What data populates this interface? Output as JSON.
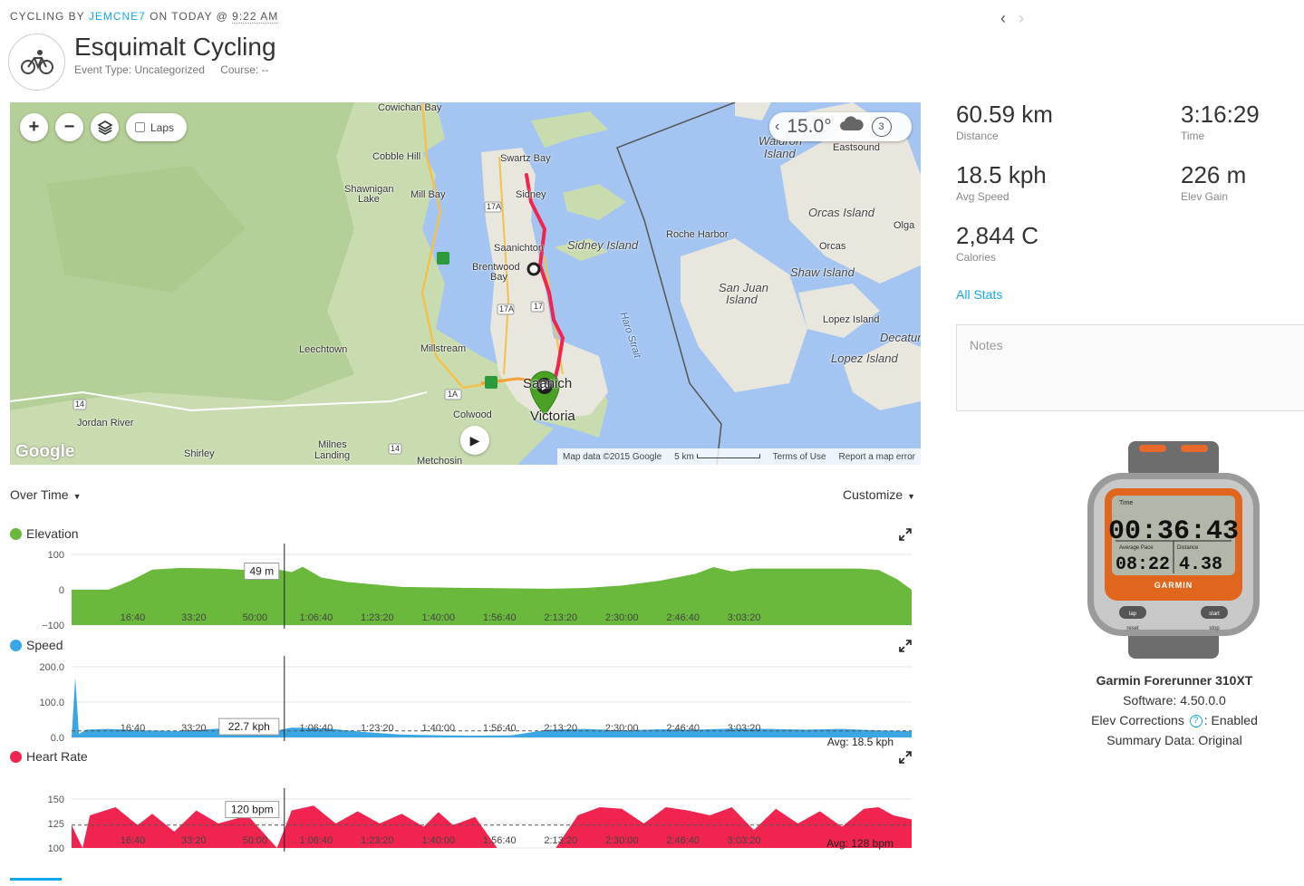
{
  "header": {
    "prefix": "CYCLING BY",
    "user": "JEMCNE7",
    "on": "ON TODAY @",
    "time": "9:22 AM",
    "title": "Esquimalt Cycling",
    "event_type": "Event Type: Uncategorized",
    "course": "Course: --",
    "activity_icon": "bicycle-icon"
  },
  "nav": {
    "prev_icon": "chevron-left-icon",
    "next_icon": "chevron-right-icon"
  },
  "map": {
    "laps_label": "Laps",
    "zoom_in": "+",
    "zoom_out": "−",
    "temperature": "15.0°",
    "weather_count": "3",
    "logo": "Google",
    "footer": {
      "map_data": "Map data ©2015 Google",
      "scale": "5 km",
      "terms": "Terms of Use",
      "report": "Report a map error"
    },
    "labels": {
      "cowichan_bay": "Cowichan Bay",
      "cobble_hill": "Cobble Hill",
      "shawnigan": "Shawnigan",
      "lake": "Lake",
      "mill_bay": "Mill Bay",
      "swartz_bay": "Swartz Bay",
      "sidney": "Sidney",
      "saanichton": "Saanichton",
      "brentwood": "Brentwood",
      "bay": "Bay",
      "sidney_island": "Sidney Island",
      "roche_harbor": "Roche Harbor",
      "waldron": "Waldron",
      "island": "Island",
      "eastsound": "Eastsound",
      "orcas_island": "Orcas Island",
      "orcas": "Orcas",
      "olga": "Olga",
      "shaw_island": "Shaw Island",
      "san_juan": "San Juan",
      "san_juan_island": "Island",
      "haro_strait": "Haro Strait",
      "lopez_island_town": "Lopez Island",
      "decatur": "Decatur",
      "lopez_island": "Lopez Island",
      "leechtown": "Leechtown",
      "millstream": "Millstream",
      "saanich": "Saanich",
      "victoria": "Victoria",
      "colwood": "Colwood",
      "jordan_river": "Jordan River",
      "shirley": "Shirley",
      "milnes": "Milnes",
      "landing": "Landing",
      "metchosin": "Metchosin",
      "hwy_17a_top": "17A",
      "hwy_17a_mid": "17A",
      "hwy_17": "17",
      "hwy_1a": "1A",
      "hwy_14_left": "14",
      "hwy_14_right": "14"
    }
  },
  "stats": [
    {
      "value": "60.59 km",
      "label": "Distance"
    },
    {
      "value": "3:16:29",
      "label": "Time"
    },
    {
      "value": "18.5 kph",
      "label": "Avg Speed"
    },
    {
      "value": "226 m",
      "label": "Elev Gain"
    },
    {
      "value": "2,844 C",
      "label": "Calories"
    }
  ],
  "all_stats": "All Stats",
  "notes_placeholder": "Notes",
  "device": {
    "name": "Garmin Forerunner 310XT",
    "software": "Software: 4.50.0.0",
    "elev_label": "Elev Corrections",
    "elev_value": ": Enabled",
    "summary": "Summary Data: Original",
    "screen_time": "00:36:43",
    "screen_pace": "08:22",
    "screen_distance": "4.38",
    "screen_time_label": "Time",
    "screen_pace_label": "Average Pace",
    "screen_distance_label": "Distance",
    "brand": "GARMIN",
    "lap": "lap",
    "start": "start",
    "reset": "reset",
    "stop": "stop"
  },
  "chart_controls": {
    "over_time": "Over Time",
    "customize": "Customize"
  },
  "colors": {
    "elevation": "#6ab83c",
    "speed": "#3aa7e4",
    "heart_rate": "#f0244f",
    "accent": "#11a9ed"
  },
  "chart_data": [
    {
      "type": "area",
      "title": "Elevation",
      "unit": "m",
      "ylim": [
        -100,
        100
      ],
      "yticks": [
        "100",
        "0",
        "−100"
      ],
      "xticks": [
        "16:40",
        "33:20",
        "50:00",
        "1:06:40",
        "1:23:20",
        "1:40:00",
        "1:56:40",
        "2:13:20",
        "2:30:00",
        "2:46:40",
        "3:03:20"
      ],
      "hover_label": "49 m",
      "x_minutes": [
        0,
        10,
        16,
        22,
        30,
        40,
        50,
        56,
        60,
        63,
        68,
        75,
        90,
        110,
        130,
        140,
        150,
        160,
        170,
        175,
        180,
        185,
        195,
        205,
        215,
        220,
        225,
        229
      ],
      "values": [
        0,
        0,
        25,
        57,
        62,
        60,
        55,
        58,
        50,
        65,
        35,
        22,
        8,
        5,
        3,
        5,
        12,
        25,
        45,
        64,
        52,
        60,
        60,
        60,
        60,
        56,
        30,
        0
      ]
    },
    {
      "type": "area",
      "title": "Speed",
      "unit": "kph",
      "ylim": [
        0,
        200
      ],
      "yticks": [
        "200.0",
        "100.0",
        "0.0"
      ],
      "xticks": [
        "16:40",
        "33:20",
        "50:00",
        "1:06:40",
        "1:23:20",
        "1:40:00",
        "1:56:40",
        "2:13:20",
        "2:30:00",
        "2:46:40",
        "3:03:20"
      ],
      "hover_label": "22.7 kph",
      "avg_label": "Avg: 18.5 kph",
      "average": 18.5,
      "x_minutes": [
        0,
        1,
        2,
        4,
        10,
        20,
        30,
        40,
        50,
        56,
        60,
        70,
        80,
        90,
        100,
        110,
        120,
        130,
        140,
        150,
        160,
        170,
        180,
        190,
        200,
        210,
        220,
        229
      ],
      "values": [
        0,
        170,
        10,
        22,
        24,
        20,
        18,
        25,
        22,
        20,
        28,
        25,
        15,
        8,
        6,
        5,
        6,
        22,
        24,
        20,
        23,
        22,
        25,
        24,
        22,
        24,
        20,
        18
      ]
    },
    {
      "type": "area",
      "title": "Heart Rate",
      "unit": "bpm",
      "ylim": [
        100,
        160
      ],
      "yticks": [
        "150",
        "125",
        "100"
      ],
      "xticks": [
        "16:40",
        "33:20",
        "50:00",
        "1:06:40",
        "1:23:20",
        "1:40:00",
        "1:56:40",
        "2:13:20",
        "2:30:00",
        "2:46:40",
        "3:03:20"
      ],
      "hover_label": "120 bpm",
      "avg_label": "Avg: 128 bpm",
      "average": 128,
      "x_minutes": [
        0,
        3,
        5,
        12,
        18,
        22,
        28,
        34,
        40,
        48,
        52,
        56,
        60,
        66,
        72,
        78,
        84,
        90,
        96,
        100,
        104,
        110,
        116,
        120,
        126,
        132,
        138,
        144,
        150,
        156,
        162,
        168,
        174,
        180,
        186,
        192,
        198,
        204,
        210,
        216,
        220,
        224,
        229
      ],
      "values": [
        128,
        100,
        140,
        150,
        128,
        142,
        120,
        146,
        130,
        140,
        120,
        100,
        146,
        152,
        130,
        145,
        130,
        142,
        126,
        144,
        128,
        138,
        100,
        100,
        100,
        100,
        140,
        150,
        148,
        130,
        150,
        146,
        140,
        150,
        122,
        148,
        130,
        145,
        126,
        148,
        150,
        140,
        135
      ]
    }
  ]
}
